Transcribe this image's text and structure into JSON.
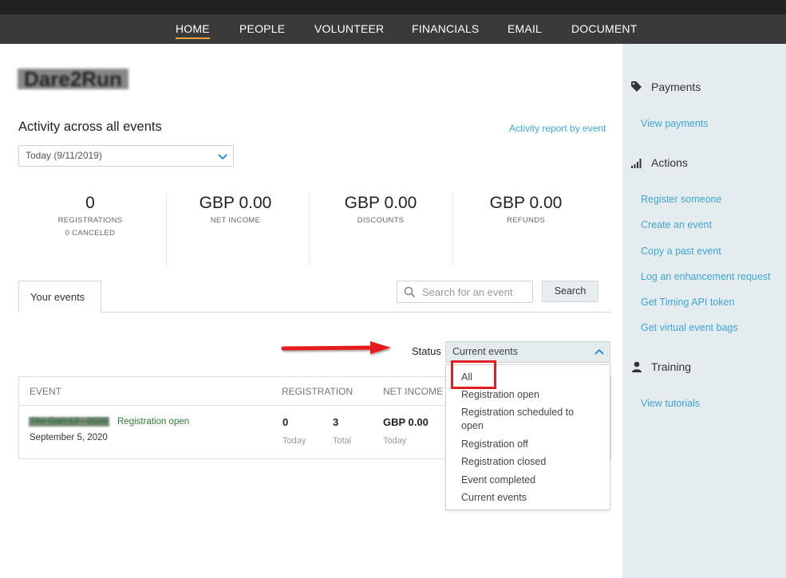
{
  "nav": {
    "items": [
      "HOME",
      "PEOPLE",
      "VOLUNTEER",
      "FINANCIALS",
      "EMAIL",
      "DOCUMENT"
    ],
    "active": "HOME"
  },
  "brand": {
    "name": "Dare2Run"
  },
  "activity": {
    "title": "Activity across all events",
    "report_link": "Activity report by event",
    "date_range": "Today (9/11/2019)"
  },
  "stats": {
    "registrations": {
      "value": "0",
      "label": "REGISTRATIONS",
      "sub": "0 CANCELED"
    },
    "net_income": {
      "value": "GBP 0.00",
      "label": "NET INCOME"
    },
    "discounts": {
      "value": "GBP 0.00",
      "label": "DISCOUNTS"
    },
    "refunds": {
      "value": "GBP 0.00",
      "label": "REFUNDS"
    }
  },
  "tabs": {
    "your_events": "Your events"
  },
  "search": {
    "placeholder": "Search for an event",
    "button": "Search"
  },
  "status": {
    "label": "Status",
    "selected": "Current events",
    "options": [
      "All",
      "Registration open",
      "Registration scheduled to open",
      "Registration off",
      "Registration closed",
      "Event completed",
      "Current events"
    ],
    "highlighted": "All"
  },
  "table": {
    "headers": {
      "event": "EVENT",
      "registration": "REGISTRATION",
      "net_income": "NET INCOME"
    },
    "rows": [
      {
        "name": "The Dare12 - 2020",
        "status": "Registration open",
        "date": "September 5, 2020",
        "reg_today": "0",
        "reg_today_label": "Today",
        "reg_total": "3",
        "reg_total_label": "Total",
        "income_today": "GBP 0.00",
        "income_today_label": "Today"
      }
    ]
  },
  "sidebar": {
    "payments": {
      "title": "Payments",
      "links": [
        "View payments"
      ]
    },
    "actions": {
      "title": "Actions",
      "links": [
        "Register someone",
        "Create an event",
        "Copy a past event",
        "Log an enhancement request",
        "Get Timing API token",
        "Get virtual event bags"
      ]
    },
    "training": {
      "title": "Training",
      "links": [
        "View tutorials"
      ]
    }
  },
  "colors": {
    "nav_bg": "#3a3a3a",
    "accent_underline": "#e8a33d",
    "link": "#3ea6d6",
    "sidebar_bg": "#e4ecef",
    "annotation_red": "#e02020",
    "status_green": "#2e7d32"
  },
  "icons": [
    "tag-icon",
    "signal-bars-icon",
    "user-icon",
    "search-icon",
    "chevron-down-icon",
    "chevron-up-icon",
    "red-arrow-annotation"
  ]
}
